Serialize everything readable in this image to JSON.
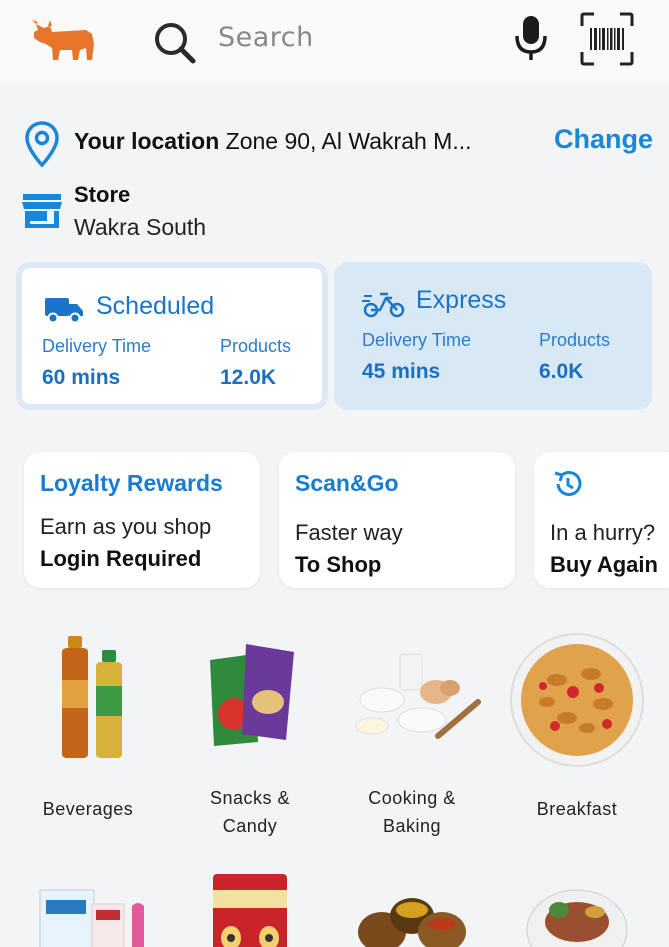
{
  "header": {
    "search_placeholder": "Search",
    "logo_icon": "cow-logo-icon",
    "icons": [
      "search-icon",
      "microphone-icon",
      "barcode-scanner-icon"
    ]
  },
  "location": {
    "label": "Your location",
    "value": "Zone 90, Al Wakrah M...",
    "change_label": "Change"
  },
  "store": {
    "label": "Store",
    "name": "Wakra South"
  },
  "delivery": {
    "scheduled": {
      "title": "Scheduled",
      "time_label": "Delivery Time",
      "products_label": "Products",
      "time_value": "60 mins",
      "products_value": "12.0K"
    },
    "express": {
      "title": "Express",
      "time_label": "Delivery Time",
      "products_label": "Products",
      "time_value": "45 mins",
      "products_value": "6.0K"
    }
  },
  "promos": [
    {
      "title": "Loyalty Rewards",
      "subtitle": "Earn as you shop",
      "action": "Login Required"
    },
    {
      "title": "Scan&Go",
      "subtitle": "Faster way",
      "action": "To Shop"
    },
    {
      "title": "",
      "subtitle": "In a hurry?",
      "action": "Buy Again"
    }
  ],
  "categories": [
    {
      "line1": "Beverages",
      "line2": ""
    },
    {
      "line1": "Snacks &",
      "line2": "Candy"
    },
    {
      "line1": "Cooking &",
      "line2": "Baking"
    },
    {
      "line1": "Breakfast",
      "line2": ""
    }
  ],
  "colors": {
    "accent": "#1a86d8",
    "logo": "#e8752a",
    "express_bg": "#d9e8f5"
  }
}
